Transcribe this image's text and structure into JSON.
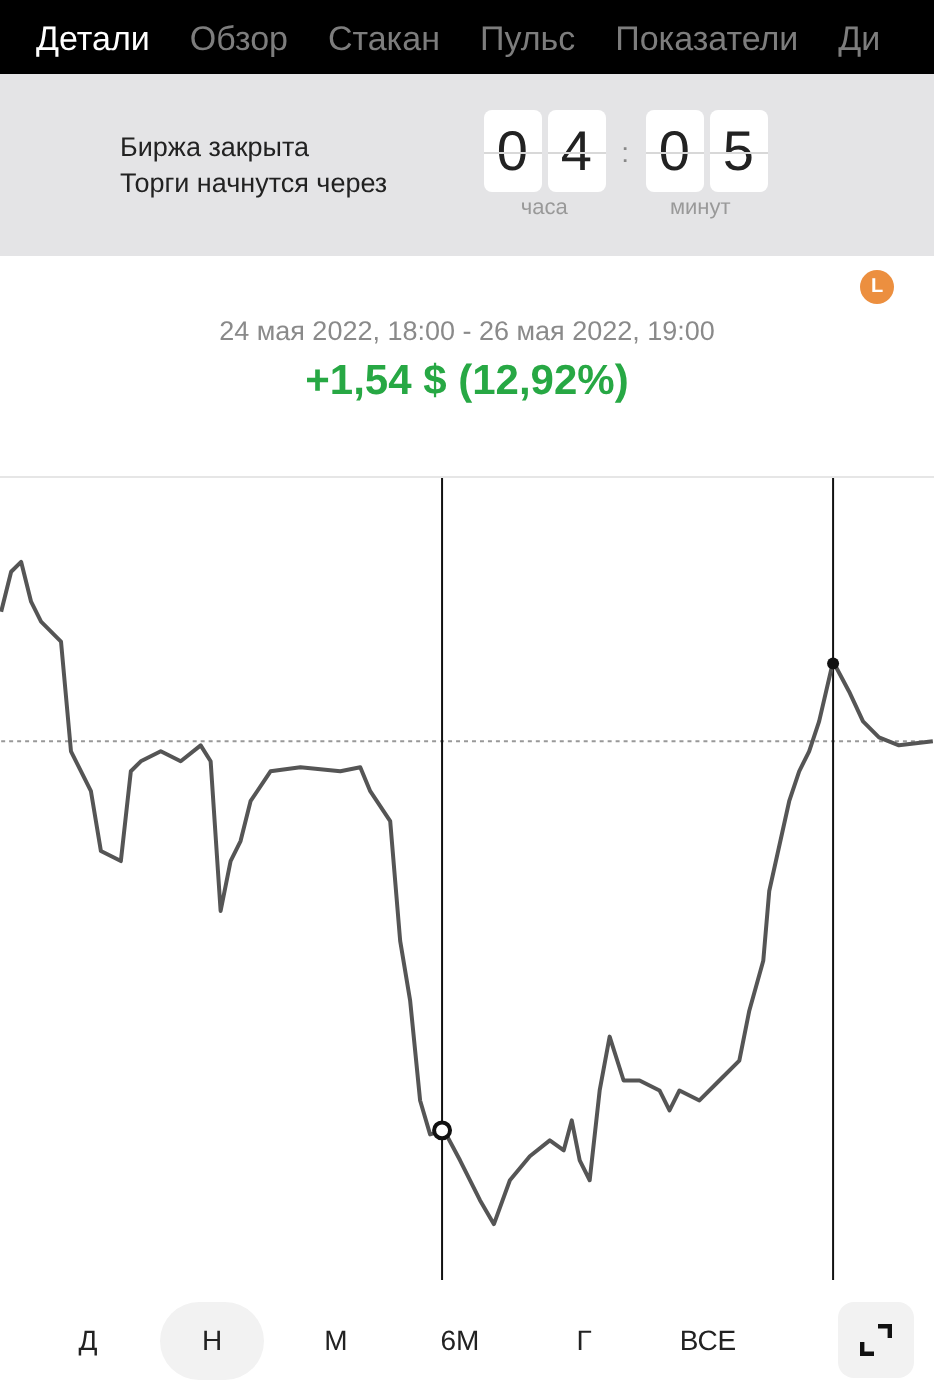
{
  "tabs": [
    {
      "label": "Детали",
      "selected": true
    },
    {
      "label": "Обзор",
      "selected": false
    },
    {
      "label": "Стакан",
      "selected": false
    },
    {
      "label": "Пульс",
      "selected": false
    },
    {
      "label": "Показатели",
      "selected": false
    },
    {
      "label": "Ди",
      "selected": false
    }
  ],
  "market_status": {
    "lines": [
      "Биржа закрыта",
      "Торги начнутся через"
    ],
    "hours": [
      "0",
      "4"
    ],
    "separator": ":",
    "minutes": [
      "0",
      "5"
    ],
    "hours_label": "часа",
    "minutes_label": "минут"
  },
  "badge": {
    "label": "L",
    "color": "#ec8f3f"
  },
  "summary": {
    "period": "24 мая 2022, 18:00 - 26 мая 2022, 19:00",
    "change": "+1,54 $ (12,92%)"
  },
  "periods": [
    {
      "label": "Д",
      "selected": false
    },
    {
      "label": "Н",
      "selected": true
    },
    {
      "label": "М",
      "selected": false
    },
    {
      "label": "6М",
      "selected": false
    },
    {
      "label": "Г",
      "selected": false
    },
    {
      "label": "ВСЕ",
      "selected": false
    }
  ]
}
